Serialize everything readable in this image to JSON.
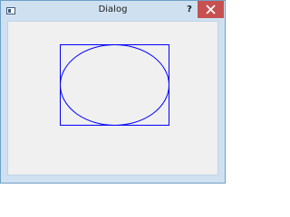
{
  "window": {
    "title": "Dialog",
    "help_label": "?",
    "app_icon": "app-window-icon",
    "close_icon": "close-icon"
  },
  "colors": {
    "titlebar": "#cfe1f1",
    "close_button": "#c75050",
    "client_background": "#f0f0f0",
    "shape_stroke": "#0000ff"
  },
  "drawing": {
    "shapes": [
      "rectangle",
      "ellipse"
    ]
  }
}
